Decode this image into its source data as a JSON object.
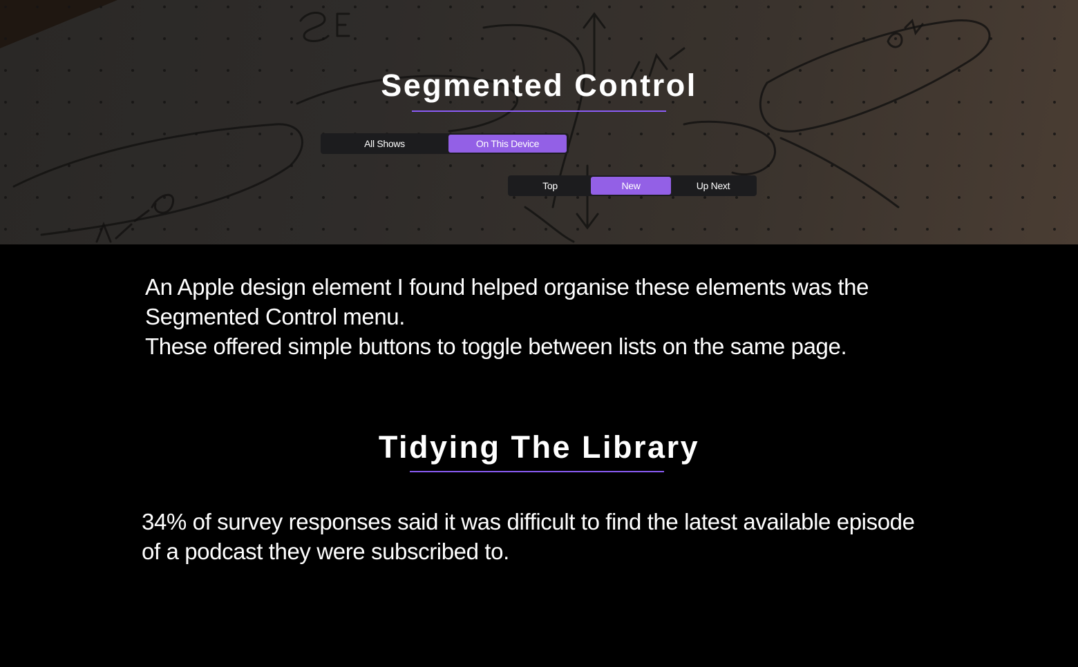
{
  "hero": {
    "title": "Segmented Control",
    "accent_color": "#8b5cf6"
  },
  "segmented_control_1": {
    "items": [
      {
        "label": "All Shows",
        "active": false
      },
      {
        "label": "On This Device",
        "active": true
      }
    ]
  },
  "segmented_control_2": {
    "items": [
      {
        "label": "Top",
        "active": false
      },
      {
        "label": "New",
        "active": true
      },
      {
        "label": "Up Next",
        "active": false
      }
    ]
  },
  "intro": {
    "line1": "An Apple design element I found helped organise these elements was the Segmented Control menu.",
    "line2": "These offered simple buttons to toggle between lists on the same page."
  },
  "section": {
    "title": "Tidying The Library",
    "body": "34% of survey responses said it was  difficult to find the latest available episode of a podcast they were  subscribed to."
  },
  "colors": {
    "background": "#000000",
    "segment_active": "#9360e6",
    "segment_track": "#1c1c1e",
    "text": "#ffffff"
  }
}
